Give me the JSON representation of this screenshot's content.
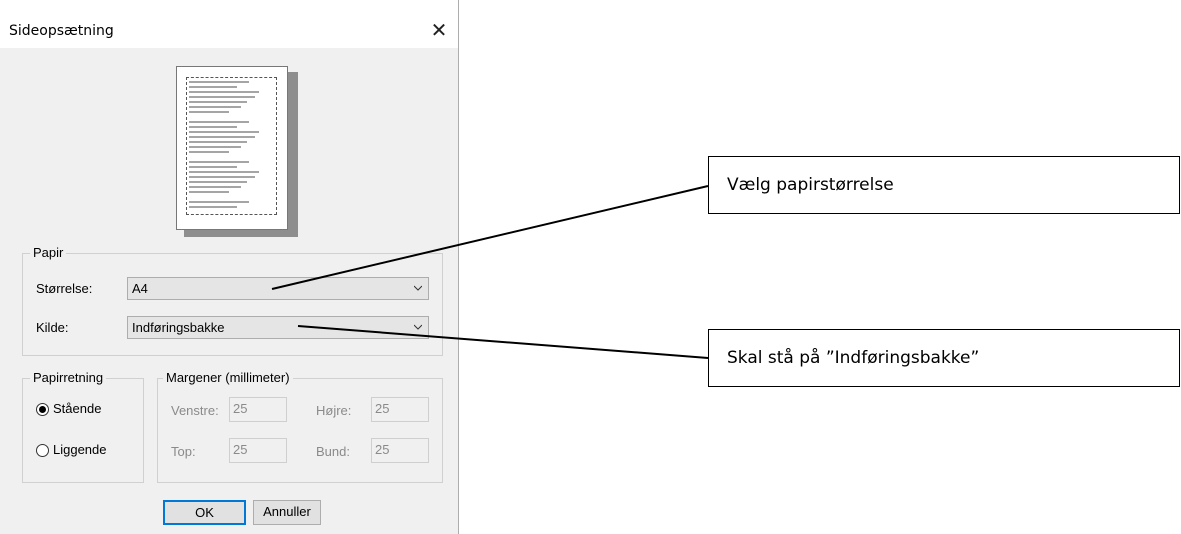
{
  "dialog": {
    "title": "Sideopsætning",
    "close_glyph": "✕",
    "paper": {
      "legend": "Papir",
      "size_label": "Størrelse:",
      "size_value": "A4",
      "source_label": "Kilde:",
      "source_value": "Indføringsbakke"
    },
    "orientation": {
      "legend": "Papirretning",
      "portrait": "Stående",
      "landscape": "Liggende",
      "selected": "portrait"
    },
    "margins": {
      "legend": "Margener (millimeter)",
      "left_label": "Venstre:",
      "left_value": "25",
      "right_label": "Højre:",
      "right_value": "25",
      "top_label": "Top:",
      "top_value": "25",
      "bottom_label": "Bund:",
      "bottom_value": "25"
    },
    "buttons": {
      "ok": "OK",
      "cancel": "Annuller"
    }
  },
  "callouts": {
    "paper_size": "Vælg papirstørrelse",
    "paper_source": "Skal stå på ”Indføringsbakke”"
  },
  "colors": {
    "dialog_bg": "#f0f0f0",
    "focus_border": "#0078d7",
    "disabled_text": "#8a8a8a"
  }
}
